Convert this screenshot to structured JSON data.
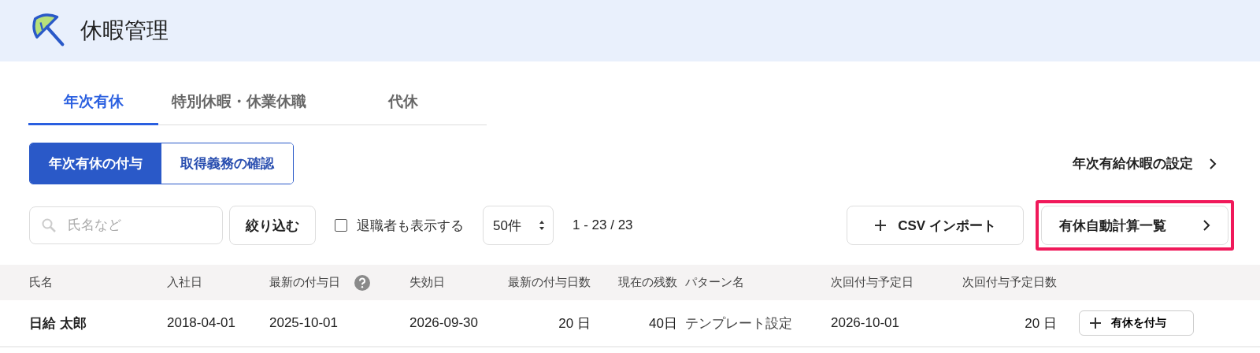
{
  "header": {
    "title": "休暇管理"
  },
  "tabs": [
    {
      "label": "年次有休",
      "selected": true
    },
    {
      "label": "特別休暇・休業休職",
      "selected": false
    },
    {
      "label": "代休",
      "selected": false
    }
  ],
  "segments": [
    {
      "label": "年次有休の付与",
      "selected": true
    },
    {
      "label": "取得義務の確認",
      "selected": false
    }
  ],
  "settings_link": "年次有給休暇の設定",
  "search": {
    "placeholder": "氏名など"
  },
  "filter_button": "絞り込む",
  "show_retired": {
    "label": "退職者も表示する",
    "checked": false
  },
  "page_size": "50件",
  "range": "1 - 23 / 23",
  "csv_button": "CSV インポート",
  "auto_calc_button": {
    "label": "有休自動計算一覧",
    "highlighted": true
  },
  "table": {
    "columns": [
      {
        "label": "氏名",
        "kind": "text"
      },
      {
        "label": "入社日",
        "kind": "text"
      },
      {
        "label": "最新の付与日",
        "kind": "text",
        "help": true
      },
      {
        "label": "失効日",
        "kind": "text"
      },
      {
        "label": "最新の付与日数",
        "kind": "number"
      },
      {
        "label": "現在の残数",
        "kind": "number"
      },
      {
        "label": "パターン名",
        "kind": "text"
      },
      {
        "label": "次回付与予定日",
        "kind": "text"
      },
      {
        "label": "次回付与予定日数",
        "kind": "number"
      }
    ],
    "rows": [
      {
        "cells": [
          "日給 太郎",
          "2018-04-01",
          "2025-10-01",
          "2026-09-30",
          "20 日",
          "40日",
          "テンプレート設定",
          "2026-10-01",
          "20 日"
        ],
        "action": "有休を付与"
      }
    ]
  }
}
